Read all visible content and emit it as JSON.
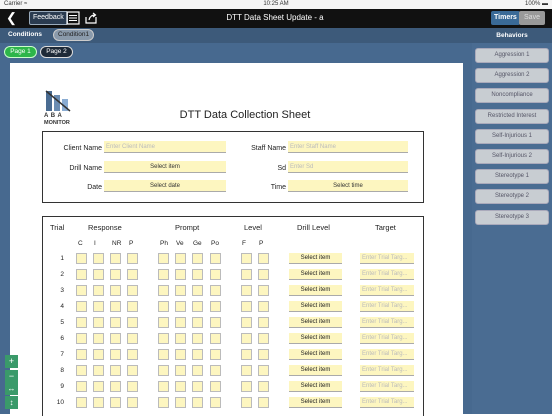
{
  "status_bar": {
    "carrier": "Carrier ≈",
    "time": "10:25 AM",
    "battery": "100% ▬"
  },
  "nav": {
    "feedback": "Feedback",
    "title": "DTT Data Sheet Update - a",
    "timers": "Timers",
    "save": "Save"
  },
  "tabs": {
    "conditions": "Conditions",
    "condition1": "Condition1"
  },
  "pages": [
    "Page 1",
    "Page 2"
  ],
  "logo": {
    "letters": "A B A",
    "word": "MONITOR"
  },
  "sheet": {
    "title": "DTT Data Collection Sheet",
    "client_label": "Client Name",
    "client_placeholder": "Enter Client Name",
    "staff_label": "Staff Name",
    "staff_placeholder": "Enter Staff Name",
    "drill_label": "Drill Name",
    "drill_value": "Select item",
    "sd_label": "Sd",
    "sd_placeholder": "Enter Sd",
    "date_label": "Date",
    "date_value": "Select date",
    "time_label": "Time",
    "time_value": "Select time"
  },
  "table": {
    "headers": {
      "trial": "Trial",
      "response": "Response",
      "prompt": "Prompt",
      "level": "Level",
      "drill_level": "Drill Level",
      "target": "Target"
    },
    "response_cols": [
      "C",
      "I",
      "NR",
      "P"
    ],
    "prompt_cols": [
      "Ph",
      "Ve",
      "Ge",
      "Po"
    ],
    "level_cols": [
      "F",
      "P"
    ],
    "trials": [
      "1",
      "2",
      "3",
      "4",
      "5",
      "6",
      "7",
      "8",
      "9",
      "10"
    ],
    "drill_level_value": "Select item",
    "target_placeholder": "Enter Trial Targ..."
  },
  "zoom_tools": [
    "+",
    "−",
    "↔",
    "↕"
  ],
  "behaviors": {
    "header": "Behaviors",
    "items": [
      "Aggression 1",
      "Aggression 2",
      "Noncompliance",
      "Restricted Interest",
      "Self-Injurious 1",
      "Self-Injurious 2",
      "Stereotype 1",
      "Stereotype 2",
      "Stereotype 3"
    ]
  }
}
